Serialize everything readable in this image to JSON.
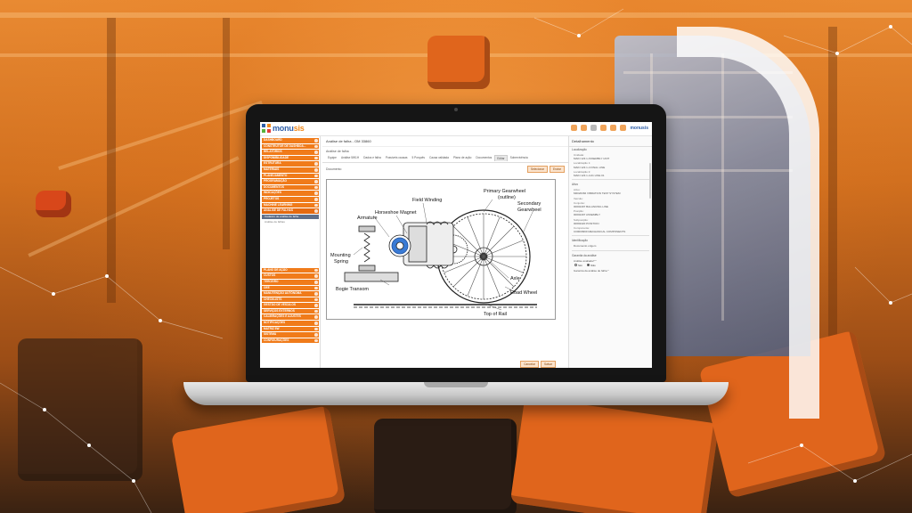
{
  "app": {
    "logo_text_a": "monu",
    "logo_text_b": "sis",
    "logo_colors": [
      "#2f5fa8",
      "#f08a1c",
      "#59b33b",
      "#e23b3b"
    ],
    "header_logo_small": "monusis"
  },
  "sidebar": {
    "top_items": [
      "DASHBOARD",
      "CONSTRUTOR DE DASHBOA...",
      "RELATÓRIOS",
      "DISPONIBILIDADE",
      "ESTRUTURA",
      "MATERIAIS",
      "PLANEJAMENTO",
      "PROGRAMAÇÃO",
      "DOCUMENTOS",
      "INDICAÇÕES",
      "PROJETOS",
      "MACHINE LEARNING",
      "ANÁLISE DE FALHAS"
    ],
    "sub_selected": "Cadastro de análise de falha",
    "sub_plain": "Análise de falhas",
    "bottom_items": [
      "PLANO DE AÇÃO",
      "CUSTOS",
      "TERCEIRO",
      "OEE",
      "MANUTENÇÃO AUTÔNOMA",
      "CHECKLISTS",
      "GESTÃO DE VEÍCULOS",
      "SERVIÇOS EXTERNOS",
      "CALIBRAÇÕES E AJUSTES",
      "NOTIFICAÇÕES",
      "MATRIZ 5W",
      "SISTEMA",
      "CONFIGURAÇÕES"
    ]
  },
  "main": {
    "page_title": "Análise de falha - OM 33860",
    "header_buttons": [
      "Imprimir DOCS",
      "Salvar"
    ],
    "section_label": "Análise de falha",
    "tabs": [
      "Equipe",
      "Análise 5W1H",
      "Dados e falha",
      "Possíveis causas",
      "5 Porquês",
      "Causa validada",
      "Plano de ação",
      "Documentos",
      "Editar",
      "Sobrevivência"
    ],
    "active_tab": 8,
    "documento_label": "Documento",
    "doc_buttons": [
      "Selecionar",
      "Enviar"
    ],
    "bottom_buttons": [
      "Cancelar",
      "Salvar"
    ]
  },
  "diagram": {
    "labels": {
      "field_winding": "Field Winding",
      "horseshoe_magnet": "Horseshoe Magnet",
      "armature": "Armature",
      "primary_gearwheel": "Primary Gearwheel",
      "primary_gearwheel_sub": "(outline)",
      "secondary_gearwheel_a": "Secondary",
      "secondary_gearwheel_b": "Gearwheel",
      "mounting_spring_a": "Mounting",
      "mounting_spring_b": "Spring",
      "axle": "Axle",
      "road_wheel": "Road Wheel",
      "bogie_transom": "Bogie Transom",
      "top_of_rail": "Top of Rail"
    }
  },
  "details": {
    "title": "Detalhamento",
    "localizacao_header": "Localização",
    "fields": [
      {
        "label": "Unidade:",
        "value": "MAIN 123.1 ASSEMBLY UNIT"
      },
      {
        "label": "Localização 1:",
        "value": "MAIN 123.1-4 FINAL LINE"
      },
      {
        "label": "Localização 2:",
        "value": "MAIN 123.1-4-01 LINE 01"
      }
    ],
    "ativo_header": "Ativo",
    "ativo_fields": [
      {
        "label": "Ativo:",
        "value": "M0020366 VIBRATION TEST SYSTEM"
      },
      {
        "label": "Veículo:",
        "value": ""
      },
      {
        "label": "Conjunto:",
        "value": "00002497 BALANCING LINE"
      },
      {
        "label": "Posição:",
        "value": "00002497 ASSEMBLY"
      },
      {
        "label": "Subposição:",
        "value": "00693420 POSITION"
      },
      {
        "label": "Componente:",
        "value": "C00009999 MECHANICAL COMPONENTS"
      }
    ],
    "identificacao_header": "Identificação",
    "identificacao_field": "Documento origem",
    "garantia_header": "Garantia da análise",
    "analise_avaliada": "Análise avaliada? *",
    "radio_yes": "Sim",
    "radio_no": "Não",
    "garantia_field": "Garantia da análise de falha *"
  }
}
